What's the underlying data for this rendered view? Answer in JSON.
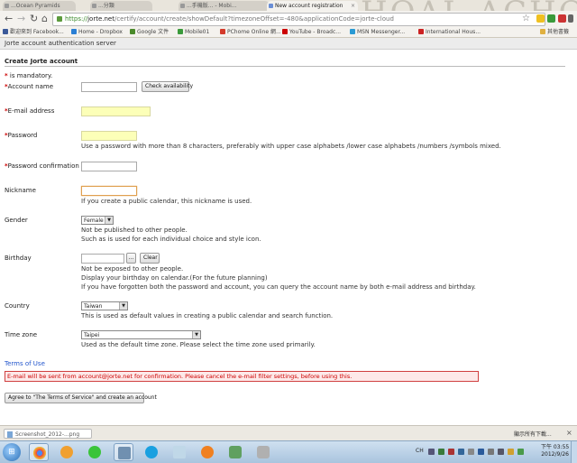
{
  "browser": {
    "tabs": [
      {
        "label": "...Ocean Pyramids",
        "active": false
      },
      {
        "label": "...分類",
        "active": false
      },
      {
        "label": "...手機版... - Mobi...",
        "active": false
      },
      {
        "label": "New account registration",
        "active": true
      }
    ],
    "url": {
      "scheme": "https://",
      "host": "jorte.net",
      "path": "/certify/account/create/showDefault?timezoneOffset=-480&applicationCode=jorte-cloud"
    },
    "bookmarks": [
      {
        "label": "歡迎來到 Facebook...",
        "color": "#3b5998"
      },
      {
        "label": "Home - Dropbox",
        "color": "#2a7fd4"
      },
      {
        "label": "Google 文件",
        "color": "#4a8a2a"
      },
      {
        "label": "Mobile01",
        "color": "#3a9a3a"
      },
      {
        "label": "PChome Online 網...",
        "color": "#d43a2a"
      },
      {
        "label": "YouTube - Broadc...",
        "color": "#cc0000"
      },
      {
        "label": "MSN Messenger...",
        "color": "#2a9ad4"
      },
      {
        "label": "International Hous...",
        "color": "#cc2222"
      }
    ],
    "other_bookmarks": "其他書籤",
    "banner_deco_text": "HOAL ACHO"
  },
  "site": {
    "header_title": "Jorte account authentication server"
  },
  "form": {
    "title": "Create Jorte account",
    "mandatory_mark": "*",
    "mandatory_note": "is mandatory.",
    "account_name_label": "Account name",
    "check_availability": "Check availability",
    "email_label": "E-mail address",
    "password_label": "Password",
    "password_note": "Use a password with more than 8 characters, preferably with upper case alphabets /lower case alphabets /numbers /symbols mixed.",
    "password_confirmation_label": "Password confirmation",
    "nickname_label": "Nickname",
    "nickname_note": "If you create a public calendar,  this nickname is used.",
    "gender_label": "Gender",
    "gender_value": "Female",
    "gender_note_1": "Not be published to other people.",
    "gender_note_2": "Such as is used for each individual choice and style icon.",
    "birthday_label": "Birthday",
    "birthday_picker": "...",
    "birthday_clear": "Clear",
    "birthday_note_1": "Not be exposed to other people.",
    "birthday_note_2": "Display your birthday on calendar.(For the future planning)",
    "birthday_note_3": "If you have forgotten both the password and account, you can query the account name by both e-mail address and birthday.",
    "country_label": "Country",
    "country_value": "Taiwan",
    "country_note": "This is used as default values in creating a public calendar and search function.",
    "timezone_label": "Time zone",
    "timezone_value": "Taipei",
    "timezone_note": "Used as the default time zone. Please select the time zone used primarily.",
    "terms_link": "Terms of Use",
    "email_warning": "E-mail will be sent from account@jorte.net for confirmation. Please cancel the e-mail filter settings, before using this.",
    "submit_label": "Agree to \"The Terms of Service\" and create an account"
  },
  "download_shelf": {
    "file": "Screenshot_2012-...png",
    "show_all": "顯示所有下載..."
  },
  "taskbar": {
    "lang": "CH",
    "time": "下午 03:55",
    "date": "2012/9/26"
  },
  "colors": {
    "required": "#cc0000",
    "link": "#2255cc",
    "autofill_yellow": "#fcffb8"
  }
}
